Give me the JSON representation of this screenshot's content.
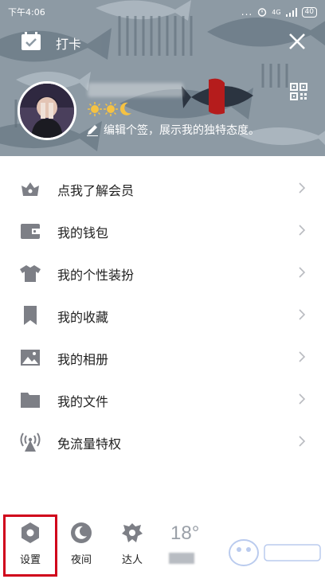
{
  "status_bar": {
    "time": "下午4:06",
    "dots": "...",
    "network": "4G",
    "battery": "40"
  },
  "header": {
    "checkin_label": "打卡",
    "signature": "编辑个签，展示我的独特态度。"
  },
  "menu": {
    "items": [
      {
        "label": "点我了解会员",
        "icon": "vip-crown-icon"
      },
      {
        "label": "我的钱包",
        "icon": "wallet-icon"
      },
      {
        "label": "我的个性装扮",
        "icon": "tshirt-icon"
      },
      {
        "label": "我的收藏",
        "icon": "bookmark-icon"
      },
      {
        "label": "我的相册",
        "icon": "photo-album-icon"
      },
      {
        "label": "我的文件",
        "icon": "folder-icon"
      },
      {
        "label": "免流量特权",
        "icon": "free-data-signal-icon"
      }
    ]
  },
  "bottom_bar": {
    "settings_label": "设置",
    "night_label": "夜间",
    "expert_label": "达人",
    "temperature": "18°"
  },
  "colors": {
    "header_bg": "#8d9aa4",
    "icon_gray": "#7d7f86",
    "highlight_red": "#d0021b"
  }
}
